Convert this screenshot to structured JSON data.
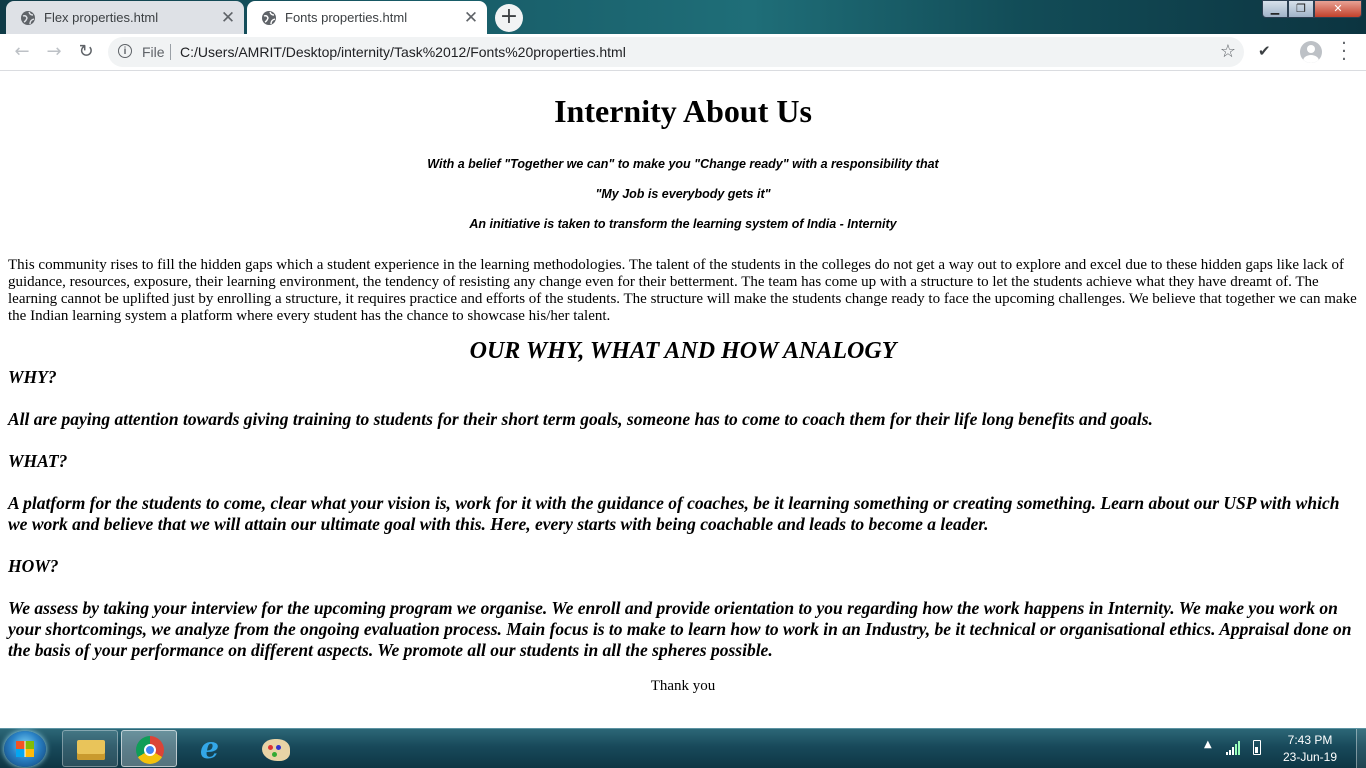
{
  "browser": {
    "tabs": [
      {
        "title": "Flex properties.html",
        "icon": "globe-icon",
        "active": false
      },
      {
        "title": "Fonts properties.html",
        "icon": "globe-icon",
        "active": true
      }
    ],
    "new_tab_label": "+",
    "close_glyph": "✕",
    "url_scheme": "File",
    "url": "C:/Users/AMRIT/Desktop/internity/Task%2012/Fonts%20properties.html"
  },
  "page": {
    "heading": "Internity About Us",
    "taglines": [
      "With a belief \"Together we can\" to make you \"Change ready\" with a responsibility that",
      "\"My Job is everybody gets it\"",
      "An initiative is taken to transform the learning system of India - Internity"
    ],
    "about_paragraph": "This community rises to fill the hidden gaps which a student experience in the learning methodologies. The talent of the students in the colleges do not get a way out to explore and excel due to these hidden gaps like lack of guidance, resources, exposure, their learning environment, the tendency of resisting any change even for their betterment. The team has come up with a structure to let the students achieve what they have dreamt of. The learning cannot be uplifted just by enrolling a structure, it requires practice and efforts of the students. The structure will make the students change ready to face the upcoming challenges. We believe that together we can make the Indian learning system a platform where every student has the chance to showcase his/her talent.",
    "analogy_heading": "OUR WHY, WHAT AND HOW ANALOGY",
    "why_label": "WHY?",
    "why_text": "All are paying attention towards giving training to students for their short term goals, someone has to come to coach them for their life long benefits and goals.",
    "what_label": "WHAT?",
    "what_text": "A platform for the students to come, clear what your vision is, work for it with the guidance of coaches, be it learning something or creating something. Learn about our USP with which we work and believe that we will attain our ultimate goal with this. Here, every starts with being coachable and leads to become a leader.",
    "how_label": "HOW?",
    "how_text": "We assess by taking your interview for the upcoming program we organise. We enroll and provide orientation to you regarding how the work happens in Internity. We make you work on your shortcomings, we analyze from the ongoing evaluation process. Main focus is to make to learn how to work in an Industry, be it technical or organisational ethics. Appraisal done on the basis of your performance on different aspects. We promote all our students in all the spheres possible.",
    "closing": "Thank you"
  },
  "taskbar": {
    "apps": [
      "folder-icon",
      "chrome-icon",
      "internet-explorer-icon",
      "paint-icon"
    ],
    "time": "7:43 PM",
    "date": "23-Jun-19"
  }
}
